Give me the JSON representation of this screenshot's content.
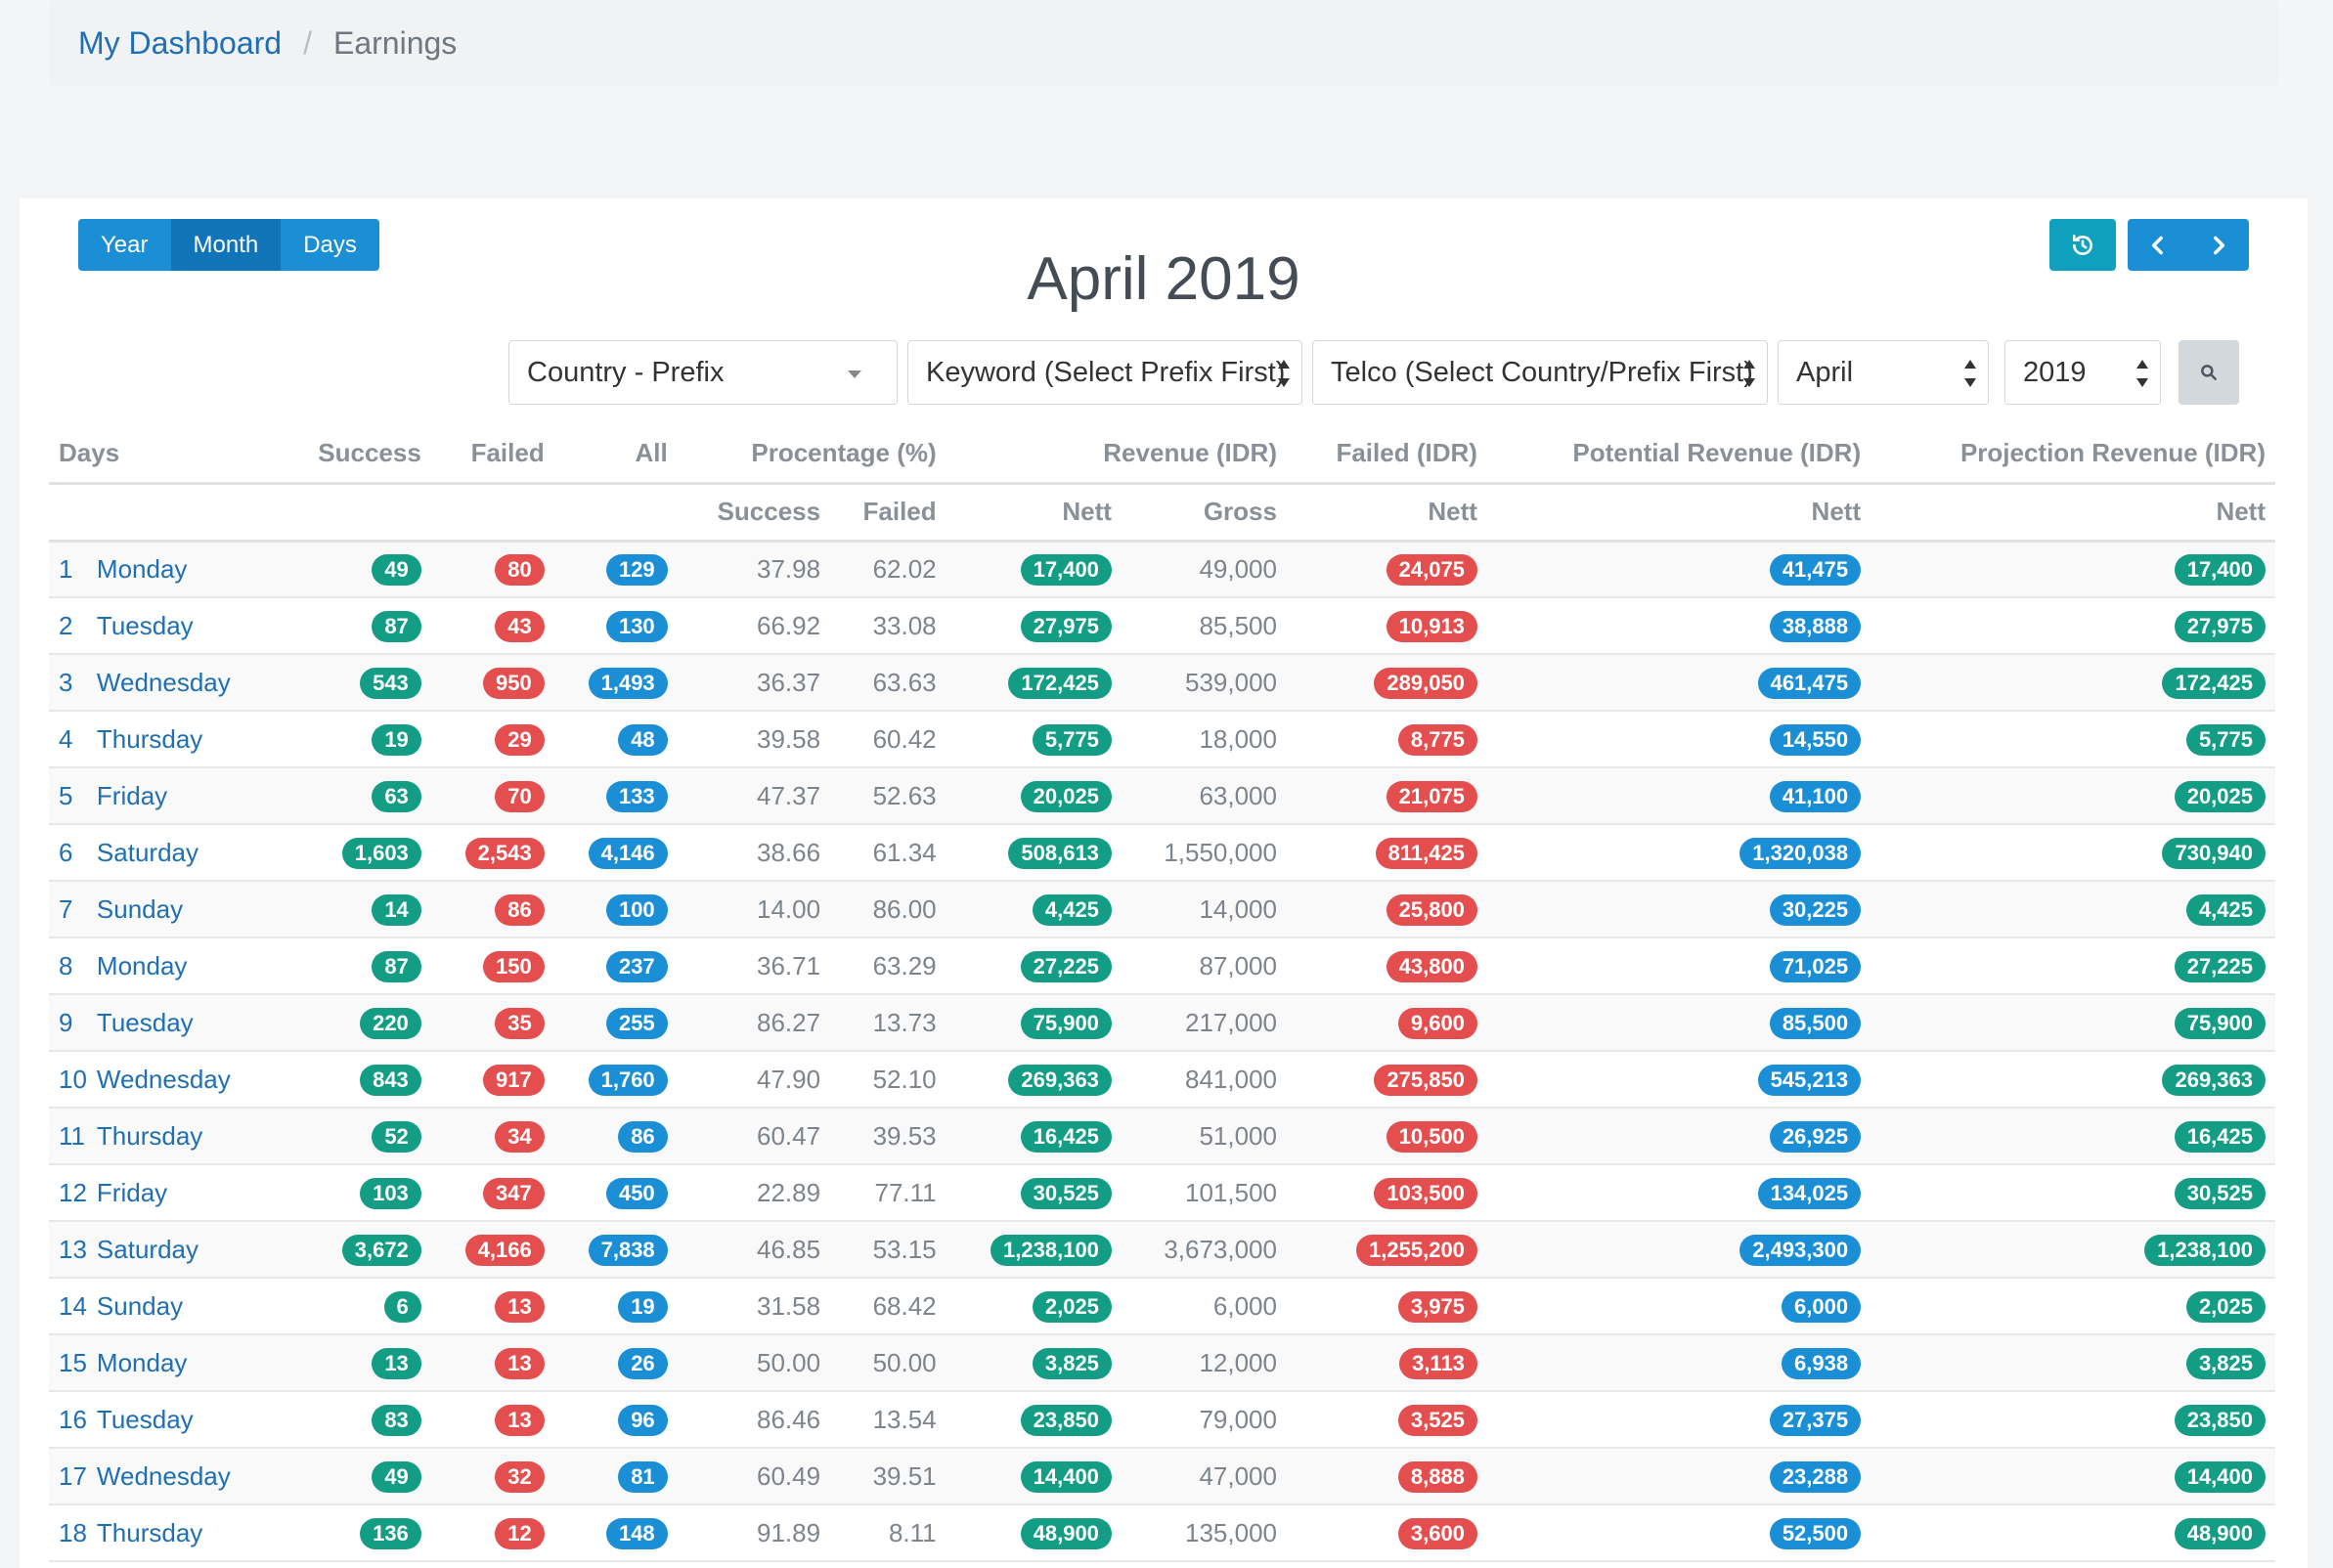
{
  "breadcrumb": {
    "home": "My Dashboard",
    "separator": "/",
    "current": "Earnings"
  },
  "view_toggle": {
    "year": "Year",
    "month": "Month",
    "days": "Days",
    "active": "Month"
  },
  "title": "April 2019",
  "icons": {
    "reset": "history-icon",
    "prev": "chevron-left-icon",
    "next": "chevron-right-icon",
    "search": "search-icon"
  },
  "filters": {
    "country": "Country - Prefix",
    "keyword": "Keyword (Select Prefix First)",
    "telco": "Telco (Select Country/Prefix First)",
    "month": "April",
    "year": "2019"
  },
  "table": {
    "headers": {
      "days": "Days",
      "success": "Success",
      "failed": "Failed",
      "all": "All",
      "percentage": "Procentage (%)",
      "revenue": "Revenue (IDR)",
      "failed_idr": "Failed (IDR)",
      "potential": "Potential Revenue (IDR)",
      "projection": "Projection Revenue (IDR)"
    },
    "subheaders": {
      "success": "Success",
      "failed": "Failed",
      "nett": "Nett",
      "gross": "Gross"
    },
    "rows": [
      {
        "no": "1",
        "day": "Monday",
        "success": "49",
        "failed": "80",
        "all": "129",
        "pct_s": "37.98",
        "pct_f": "62.02",
        "rev_nett": "17,400",
        "rev_gross": "49,000",
        "failed_nett": "24,075",
        "potential": "41,475",
        "projection": "17,400"
      },
      {
        "no": "2",
        "day": "Tuesday",
        "success": "87",
        "failed": "43",
        "all": "130",
        "pct_s": "66.92",
        "pct_f": "33.08",
        "rev_nett": "27,975",
        "rev_gross": "85,500",
        "failed_nett": "10,913",
        "potential": "38,888",
        "projection": "27,975"
      },
      {
        "no": "3",
        "day": "Wednesday",
        "success": "543",
        "failed": "950",
        "all": "1,493",
        "pct_s": "36.37",
        "pct_f": "63.63",
        "rev_nett": "172,425",
        "rev_gross": "539,000",
        "failed_nett": "289,050",
        "potential": "461,475",
        "projection": "172,425"
      },
      {
        "no": "4",
        "day": "Thursday",
        "success": "19",
        "failed": "29",
        "all": "48",
        "pct_s": "39.58",
        "pct_f": "60.42",
        "rev_nett": "5,775",
        "rev_gross": "18,000",
        "failed_nett": "8,775",
        "potential": "14,550",
        "projection": "5,775"
      },
      {
        "no": "5",
        "day": "Friday",
        "success": "63",
        "failed": "70",
        "all": "133",
        "pct_s": "47.37",
        "pct_f": "52.63",
        "rev_nett": "20,025",
        "rev_gross": "63,000",
        "failed_nett": "21,075",
        "potential": "41,100",
        "projection": "20,025"
      },
      {
        "no": "6",
        "day": "Saturday",
        "success": "1,603",
        "failed": "2,543",
        "all": "4,146",
        "pct_s": "38.66",
        "pct_f": "61.34",
        "rev_nett": "508,613",
        "rev_gross": "1,550,000",
        "failed_nett": "811,425",
        "potential": "1,320,038",
        "projection": "730,940"
      },
      {
        "no": "7",
        "day": "Sunday",
        "success": "14",
        "failed": "86",
        "all": "100",
        "pct_s": "14.00",
        "pct_f": "86.00",
        "rev_nett": "4,425",
        "rev_gross": "14,000",
        "failed_nett": "25,800",
        "potential": "30,225",
        "projection": "4,425"
      },
      {
        "no": "8",
        "day": "Monday",
        "success": "87",
        "failed": "150",
        "all": "237",
        "pct_s": "36.71",
        "pct_f": "63.29",
        "rev_nett": "27,225",
        "rev_gross": "87,000",
        "failed_nett": "43,800",
        "potential": "71,025",
        "projection": "27,225"
      },
      {
        "no": "9",
        "day": "Tuesday",
        "success": "220",
        "failed": "35",
        "all": "255",
        "pct_s": "86.27",
        "pct_f": "13.73",
        "rev_nett": "75,900",
        "rev_gross": "217,000",
        "failed_nett": "9,600",
        "potential": "85,500",
        "projection": "75,900"
      },
      {
        "no": "10",
        "day": "Wednesday",
        "success": "843",
        "failed": "917",
        "all": "1,760",
        "pct_s": "47.90",
        "pct_f": "52.10",
        "rev_nett": "269,363",
        "rev_gross": "841,000",
        "failed_nett": "275,850",
        "potential": "545,213",
        "projection": "269,363"
      },
      {
        "no": "11",
        "day": "Thursday",
        "success": "52",
        "failed": "34",
        "all": "86",
        "pct_s": "60.47",
        "pct_f": "39.53",
        "rev_nett": "16,425",
        "rev_gross": "51,000",
        "failed_nett": "10,500",
        "potential": "26,925",
        "projection": "16,425"
      },
      {
        "no": "12",
        "day": "Friday",
        "success": "103",
        "failed": "347",
        "all": "450",
        "pct_s": "22.89",
        "pct_f": "77.11",
        "rev_nett": "30,525",
        "rev_gross": "101,500",
        "failed_nett": "103,500",
        "potential": "134,025",
        "projection": "30,525"
      },
      {
        "no": "13",
        "day": "Saturday",
        "success": "3,672",
        "failed": "4,166",
        "all": "7,838",
        "pct_s": "46.85",
        "pct_f": "53.15",
        "rev_nett": "1,238,100",
        "rev_gross": "3,673,000",
        "failed_nett": "1,255,200",
        "potential": "2,493,300",
        "projection": "1,238,100"
      },
      {
        "no": "14",
        "day": "Sunday",
        "success": "6",
        "failed": "13",
        "all": "19",
        "pct_s": "31.58",
        "pct_f": "68.42",
        "rev_nett": "2,025",
        "rev_gross": "6,000",
        "failed_nett": "3,975",
        "potential": "6,000",
        "projection": "2,025"
      },
      {
        "no": "15",
        "day": "Monday",
        "success": "13",
        "failed": "13",
        "all": "26",
        "pct_s": "50.00",
        "pct_f": "50.00",
        "rev_nett": "3,825",
        "rev_gross": "12,000",
        "failed_nett": "3,113",
        "potential": "6,938",
        "projection": "3,825"
      },
      {
        "no": "16",
        "day": "Tuesday",
        "success": "83",
        "failed": "13",
        "all": "96",
        "pct_s": "86.46",
        "pct_f": "13.54",
        "rev_nett": "23,850",
        "rev_gross": "79,000",
        "failed_nett": "3,525",
        "potential": "27,375",
        "projection": "23,850"
      },
      {
        "no": "17",
        "day": "Wednesday",
        "success": "49",
        "failed": "32",
        "all": "81",
        "pct_s": "60.49",
        "pct_f": "39.51",
        "rev_nett": "14,400",
        "rev_gross": "47,000",
        "failed_nett": "8,888",
        "potential": "23,288",
        "projection": "14,400"
      },
      {
        "no": "18",
        "day": "Thursday",
        "success": "136",
        "failed": "12",
        "all": "148",
        "pct_s": "91.89",
        "pct_f": "8.11",
        "rev_nett": "48,900",
        "rev_gross": "135,000",
        "failed_nett": "3,600",
        "potential": "52,500",
        "projection": "48,900"
      }
    ]
  },
  "colors": {
    "success": "#139d84",
    "failed": "#e44e4e",
    "all": "#1a8fd6",
    "link": "#1f6fb4"
  }
}
